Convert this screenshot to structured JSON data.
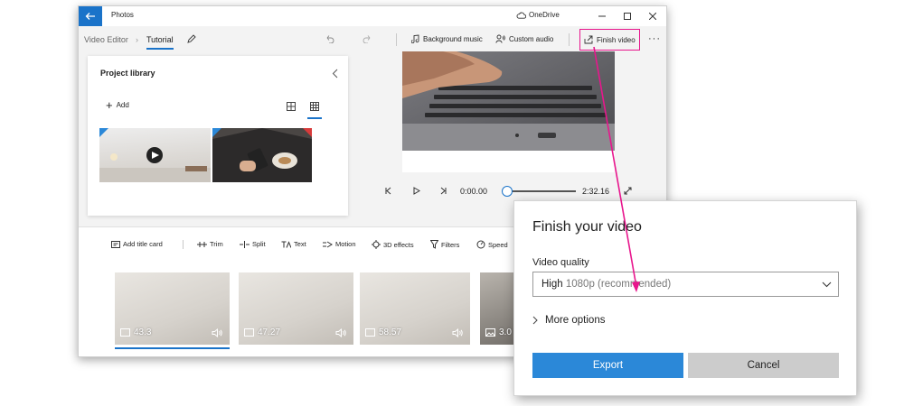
{
  "window": {
    "app_title": "Photos",
    "onedrive": "OneDrive",
    "accent_color": "#1a73c9"
  },
  "toolbar": {
    "breadcrumb_root": "Video Editor",
    "breadcrumb_current": "Tutorial",
    "background_music": "Background music",
    "custom_audio": "Custom audio",
    "finish_video": "Finish video"
  },
  "library": {
    "title": "Project library",
    "add": "Add"
  },
  "player": {
    "current_time": "0:00.00",
    "total_time": "2:32.16",
    "progress": 0
  },
  "editor_tools": [
    {
      "label": "Add title card",
      "icon": "title-card-icon"
    },
    {
      "label": "Trim",
      "icon": "trim-icon"
    },
    {
      "label": "Split",
      "icon": "split-icon"
    },
    {
      "label": "Text",
      "icon": "text-icon"
    },
    {
      "label": "Motion",
      "icon": "motion-icon"
    },
    {
      "label": "3D effects",
      "icon": "3d-effects-icon"
    },
    {
      "label": "Filters",
      "icon": "filters-icon"
    },
    {
      "label": "Speed",
      "icon": "speed-icon"
    }
  ],
  "storyboard": [
    {
      "duration": "43.3",
      "type": "video",
      "selected": true
    },
    {
      "duration": "47.27",
      "type": "video",
      "selected": false
    },
    {
      "duration": "58.57",
      "type": "video",
      "selected": false
    },
    {
      "duration": "3.0",
      "type": "image",
      "selected": false
    }
  ],
  "dialog": {
    "title": "Finish your video",
    "quality_label": "Video quality",
    "quality_value_strong": "High",
    "quality_value_rest": "1080p (recommended)",
    "more_options": "More options",
    "export": "Export",
    "cancel": "Cancel",
    "export_color": "#2b88d8"
  },
  "annotation": {
    "color": "#e8168d"
  }
}
